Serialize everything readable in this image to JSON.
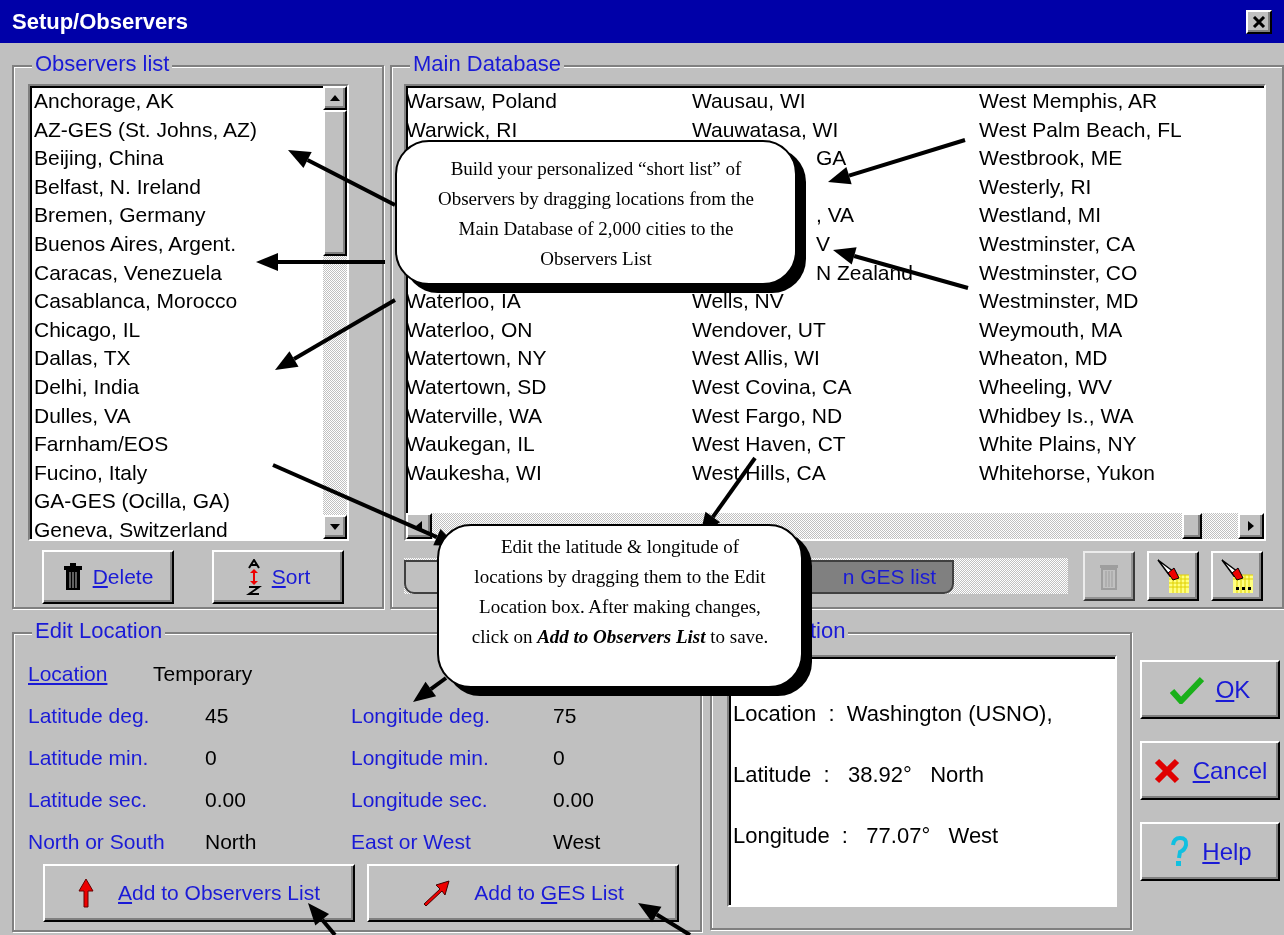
{
  "window": {
    "title": "Setup/Observers"
  },
  "observers_list": {
    "title": "Observers list",
    "items": [
      "Anchorage, AK",
      "AZ-GES (St. Johns, AZ)",
      "Beijing, China",
      "Belfast, N. Ireland",
      "Bremen, Germany",
      "Buenos Aires, Argent.",
      "Caracas, Venezuela",
      "Casablanca, Morocco",
      "Chicago, IL",
      "Dallas, TX",
      "Delhi, India",
      "Dulles, VA",
      "Farnham/EOS",
      "Fucino, Italy",
      "GA-GES (Ocilla, GA)",
      "Geneva, Switzerland"
    ],
    "buttons": [
      {
        "kind": "delete",
        "mnemonic": "D",
        "after": "elete"
      },
      {
        "kind": "sort",
        "mnemonic": "S",
        "after": "ort"
      }
    ]
  },
  "main_database": {
    "title": "Main Database",
    "rows": [
      {
        "column_1": "Warsaw, Poland",
        "column_2": "Wausau, WI",
        "column_3": "West Memphis, AR"
      },
      {
        "column_1": "Warwick, RI",
        "column_2": "Wauwatasa, WI",
        "column_3": "West Palm Beach, FL"
      },
      {
        "column_2": "GA",
        "column_3": "Westbrook, ME"
      },
      {
        "column_3": "Westerly, RI"
      },
      {
        "column_2": ", VA",
        "column_3": "Westland, MI"
      },
      {
        "column_2": "V",
        "column_3": "Westminster, CA"
      },
      {
        "column_2": "N Zealand",
        "column_3": "Westminster, CO"
      },
      {
        "column_1": "Waterloo, IA",
        "column_2": "Wells, NV",
        "column_3": "Westminster, MD"
      },
      {
        "column_1": "Waterloo, ON",
        "column_2": "Wendover, UT",
        "column_3": "Weymouth, MA"
      },
      {
        "column_1": "Watertown, NY",
        "column_2": "West Allis, WI",
        "column_3": "Wheaton, MD"
      },
      {
        "column_1": "Watertown, SD",
        "column_2": "West Covina, CA",
        "column_3": "Wheeling, WV"
      },
      {
        "column_1": "Waterville, WA",
        "column_2": "West Fargo, ND",
        "column_3": "Whidbey Is., WA"
      },
      {
        "column_1": "Waukegan, IL",
        "column_2": "West Haven, CT",
        "column_3": "White Plains, NY"
      },
      {
        "column_1": "Waukesha, WI",
        "column_2": "West Hills, CA",
        "column_3": "Whitehorse, Yukon"
      }
    ],
    "tabs": [
      {
        "selected": true
      },
      {
        "label": "n GES list",
        "selected": false
      }
    ],
    "tool_buttons": [
      {
        "kind": "trash",
        "disabled": true
      },
      {
        "kind": "flashlight",
        "disabled": false
      },
      {
        "kind": "flashlight-dots",
        "disabled": false
      }
    ]
  },
  "edit_location": {
    "title": "Edit Location",
    "location_label": "Location",
    "location_value": "Temporary",
    "fields": [
      {
        "label": "Latitude deg.",
        "value": "45"
      },
      {
        "label": "Longitude deg.",
        "value": "75"
      },
      {
        "label": "Latitude min.",
        "value": "0"
      },
      {
        "label": "Longitude min.",
        "value": "0"
      },
      {
        "label": "Latitude sec.",
        "value": "0.00"
      },
      {
        "label": "Longitude sec.",
        "value": "0.00"
      },
      {
        "label": "North or South",
        "value": "North"
      },
      {
        "label": "East or West",
        "value": "West"
      }
    ],
    "buttons": [
      {
        "kind": "up-arrow",
        "mnemonic": "A",
        "after": "dd to Observers List"
      },
      {
        "kind": "diagonal-arrow",
        "before": "Add to ",
        "mnemonic": "G",
        "after": "ES List"
      }
    ]
  },
  "location_info": {
    "title": "tion",
    "lines": [
      "Location  :  Washington (USNO),",
      "Latitude  :   38.92°   North",
      "Longitude  :   77.07°   West"
    ]
  },
  "dialog_buttons": [
    {
      "kind": "ok",
      "mnemonic": "O",
      "after": "K"
    },
    {
      "kind": "cancel",
      "mnemonic": "C",
      "after": "ancel"
    },
    {
      "kind": "help",
      "mnemonic": "H",
      "after": "elp"
    }
  ],
  "annotations": [
    "Build your personalized “short list” of Observers by dragging locations from the Main Database of 2,000 cities to the Observers List",
    "Edit the latitude & longitude of locations by  dragging them to the Edit Location box.  After making changes, click on **Add to Observers List** to save."
  ]
}
